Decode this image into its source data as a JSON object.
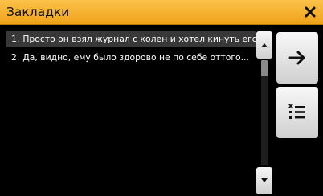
{
  "window": {
    "title": "Закладки",
    "close_icon": "close-icon"
  },
  "bookmarks": {
    "items": [
      {
        "number": "1.",
        "text": "Просто он взял журнал с колен и хотел кинуть его на...",
        "selected": true
      },
      {
        "number": "2.",
        "text": "Да, видно, ему было здорово не по себе оттого...",
        "selected": false
      }
    ]
  },
  "scrollbar": {
    "up_icon": "triangle-up-icon",
    "down_icon": "triangle-down-icon"
  },
  "actions": {
    "go_icon": "arrow-right-icon",
    "delete_list_icon": "delete-list-icon"
  },
  "colors": {
    "titlebar": "#f0a21a",
    "background": "#000000",
    "selected_row": "#383838"
  }
}
